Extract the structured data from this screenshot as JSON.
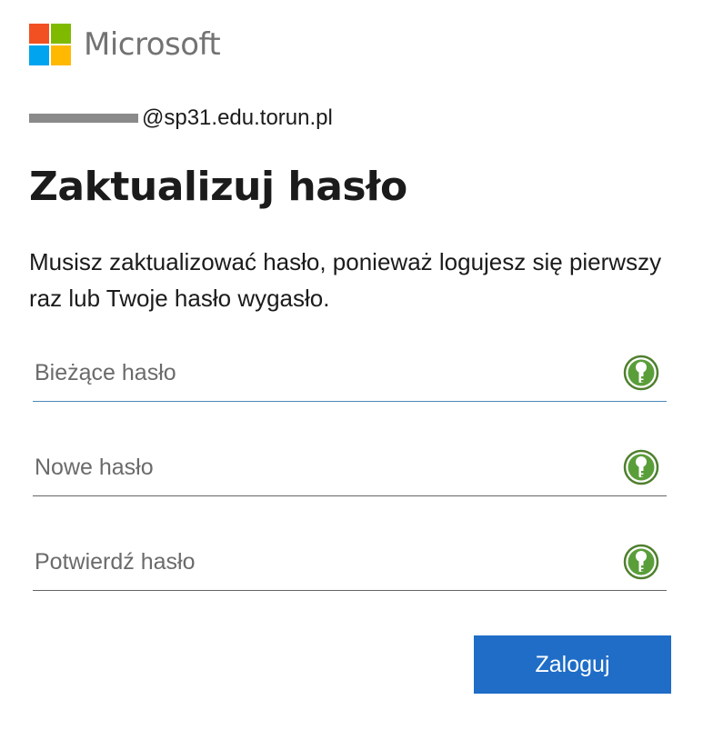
{
  "brand": {
    "name": "Microsoft",
    "logo_colors": [
      "#f25022",
      "#7fba00",
      "#00a4ef",
      "#ffb900"
    ]
  },
  "account": {
    "email_suffix": "@sp31.edu.torun.pl"
  },
  "page": {
    "title": "Zaktualizuj hasło",
    "description": "Musisz zaktualizować hasło, ponieważ logujesz się pierwszy raz lub Twoje hasło wygasło."
  },
  "fields": {
    "current_password": {
      "placeholder": "Bieżące hasło",
      "value": ""
    },
    "new_password": {
      "placeholder": "Nowe hasło",
      "value": ""
    },
    "confirm_password": {
      "placeholder": "Potwierdź hasło",
      "value": ""
    }
  },
  "icons": {
    "password_manager": "keepass-key-icon",
    "icon_color": "#5a9e3a"
  },
  "actions": {
    "submit_label": "Zaloguj",
    "submit_color": "#1f6dc7"
  }
}
